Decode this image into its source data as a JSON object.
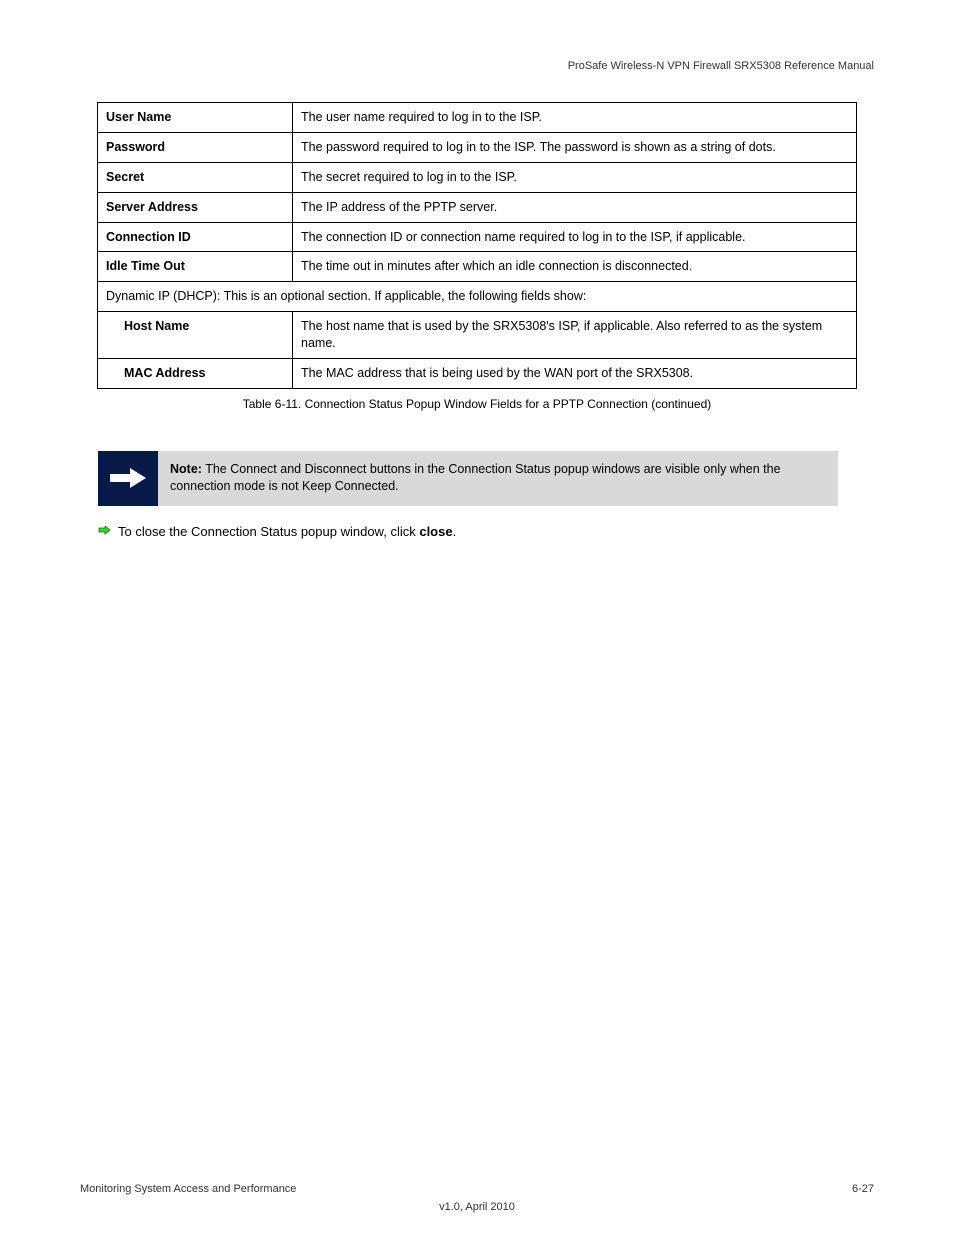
{
  "header": "ProSafe Wireless-N VPN Firewall SRX5308 Reference Manual",
  "rows": [
    {
      "label": "User Name",
      "desc": "The user name required to log in to the ISP."
    },
    {
      "label": "Password",
      "desc": "The password required to log in to the ISP. The password is shown as a string of dots."
    },
    {
      "label": "Secret",
      "desc": "The secret required to log in to the ISP."
    },
    {
      "label": "Server Address",
      "desc": "The IP address of the PPTP server."
    },
    {
      "label": "Connection ID",
      "desc": "The connection ID or connection name required to log in to the ISP, if applicable."
    },
    {
      "label": "Idle Time Out",
      "desc": "The time out in minutes after which an idle connection is disconnected."
    },
    {
      "full": true,
      "desc": "Dynamic IP (DHCP): This is an optional section. If applicable, the following fields show:"
    },
    {
      "label": "Host Name",
      "desc": "The host name that is used by the SRX5308's ISP, if applicable. Also referred to as the system name.",
      "indent": true
    },
    {
      "label": "MAC Address",
      "desc": "The MAC address that is being used by the WAN port of the SRX5308.",
      "indent": true
    }
  ],
  "caption": "Table 6-11. Connection Status Popup Window Fields for a PPTP Connection (continued)",
  "note": {
    "prefix": "Note:",
    "body": "The Connect and Disconnect buttons in the Connection Status popup windows are visible only when the connection mode is not Keep Connected."
  },
  "step": {
    "prefix": "To close the Connection Status popup window, click ",
    "button_label": "close"
  },
  "footer": {
    "left": "Monitoring System Access and Performance",
    "right": "6-27",
    "note": "v1.0, April 2010"
  }
}
